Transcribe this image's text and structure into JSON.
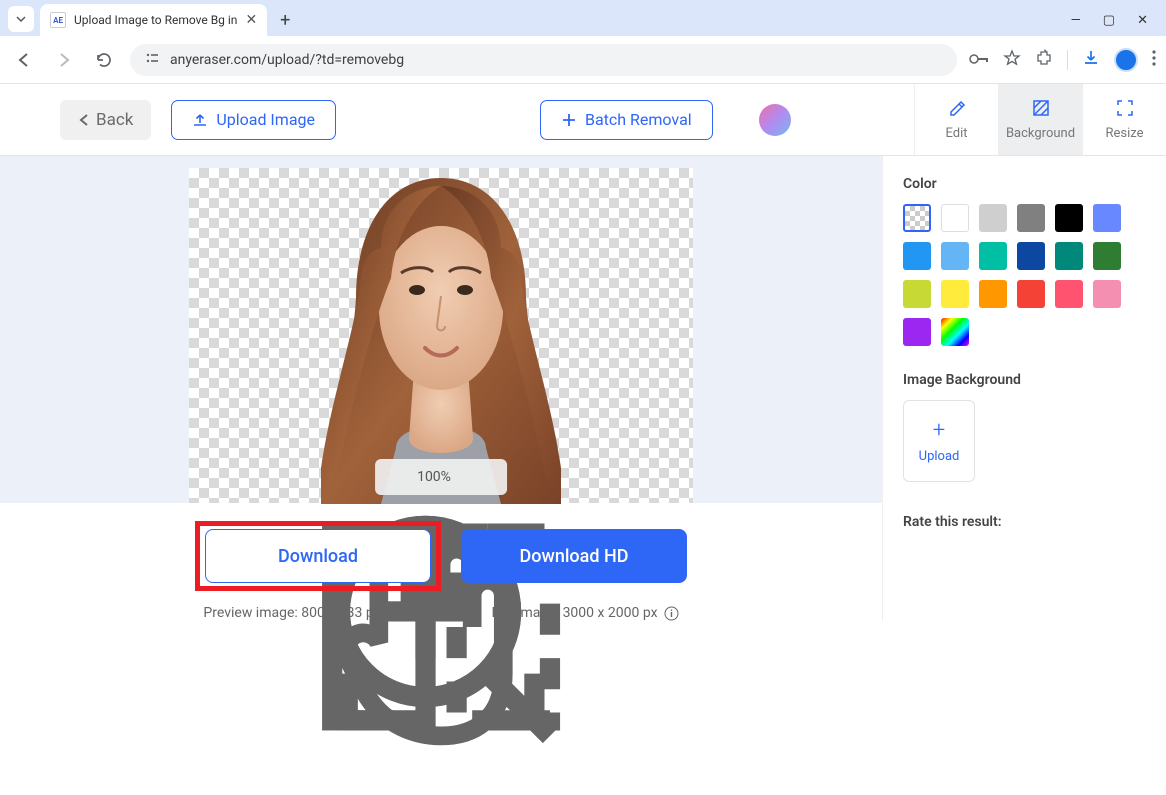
{
  "browser": {
    "tab_title": "Upload Image to Remove Bg in",
    "favicon_text": "AE",
    "url": "anyeraser.com/upload/?td=removebg"
  },
  "appbar": {
    "back_label": "Back",
    "upload_label": "Upload Image",
    "batch_label": "Batch Removal",
    "tabs": {
      "edit": "Edit",
      "background": "Background",
      "resize": "Resize"
    }
  },
  "zoom": {
    "level": "100%"
  },
  "download": {
    "standard_label": "Download",
    "hd_label": "Download HD",
    "preview_caption": "Preview image: 800 x 533 px",
    "full_caption": "Full image: 3000 x 2000 px"
  },
  "sidebar": {
    "color_heading": "Color",
    "colors": [
      {
        "name": "transparent",
        "value": "transparent"
      },
      {
        "name": "white",
        "value": "#ffffff"
      },
      {
        "name": "light-gray",
        "value": "#cfcfcf"
      },
      {
        "name": "gray",
        "value": "#808080"
      },
      {
        "name": "black",
        "value": "#000000"
      },
      {
        "name": "indigo",
        "value": "#6788ff"
      },
      {
        "name": "blue",
        "value": "#2196f3"
      },
      {
        "name": "light-blue",
        "value": "#64b5f6"
      },
      {
        "name": "teal",
        "value": "#00bfa5"
      },
      {
        "name": "navy",
        "value": "#0d47a1"
      },
      {
        "name": "dark-teal",
        "value": "#00897b"
      },
      {
        "name": "green",
        "value": "#2e7d32"
      },
      {
        "name": "lime",
        "value": "#c6d935"
      },
      {
        "name": "yellow",
        "value": "#ffeb3b"
      },
      {
        "name": "orange",
        "value": "#ff9800"
      },
      {
        "name": "red",
        "value": "#f44336"
      },
      {
        "name": "pink-red",
        "value": "#ff5370"
      },
      {
        "name": "pink",
        "value": "#f48fb1"
      },
      {
        "name": "purple",
        "value": "#9c27f0"
      },
      {
        "name": "multicolor",
        "value": "multicolor"
      }
    ],
    "image_bg_heading": "Image Background",
    "upload_tile_label": "Upload",
    "rate_heading": "Rate this result:"
  }
}
